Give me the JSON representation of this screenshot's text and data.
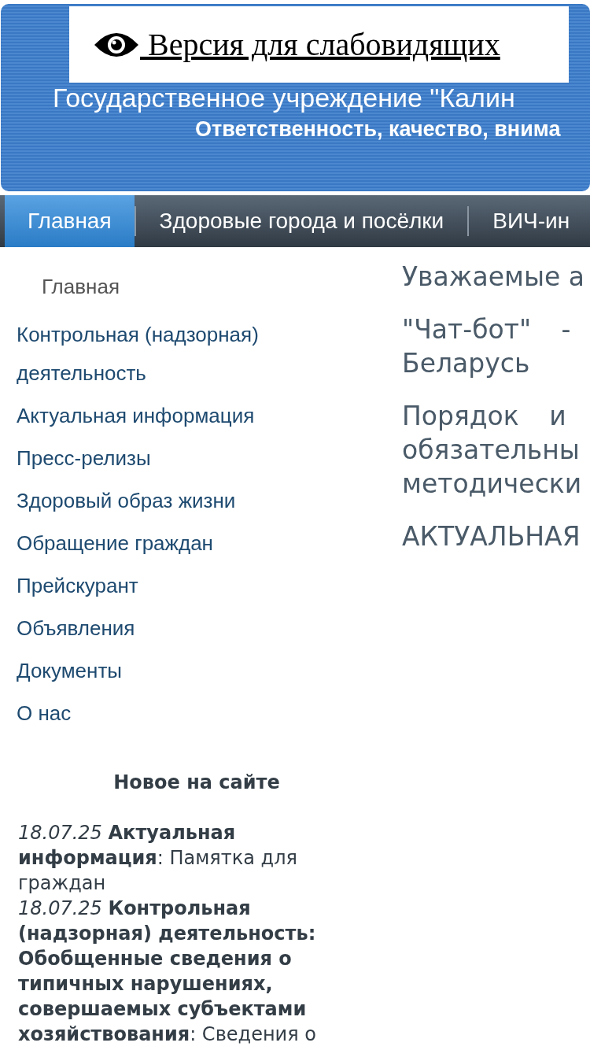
{
  "accessibility_link": {
    "label": " Версия для слабовидящих"
  },
  "header": {
    "title": "Государственное учреждение \"Калин",
    "subtitle": "Ответственность, качество, внима"
  },
  "nav": [
    {
      "label": "Главная",
      "selected": true
    },
    {
      "label": "Здоровые города и посёлки",
      "selected": false
    },
    {
      "label": "ВИЧ-ин",
      "selected": false
    }
  ],
  "sidebar": {
    "items": [
      {
        "label": "Главная",
        "selected": true
      },
      {
        "label": "Контрольная (надзорная) деятельность",
        "selected": false
      },
      {
        "label": "Актуальная информация",
        "selected": false
      },
      {
        "label": "Пресс-релизы",
        "selected": false
      },
      {
        "label": "Здоровый образ жизни",
        "selected": false
      },
      {
        "label": "Обращение граждан",
        "selected": false
      },
      {
        "label": "Прейскурант",
        "selected": false
      },
      {
        "label": "Объявления",
        "selected": false
      },
      {
        "label": "Документы",
        "selected": false
      },
      {
        "label": "О нас",
        "selected": false
      }
    ]
  },
  "news": {
    "title": "Новое на сайте",
    "items": [
      {
        "date": "18.07.25",
        "section": "Актуальная информация",
        "text": ": Памятка для граждан"
      },
      {
        "date": "18.07.25",
        "section": "Контрольная (надзорная) деятельность: Обобщенные сведения о типичных нарушениях, совершаемых субъектами хозяйствования",
        "text": ": Сведения о"
      }
    ]
  },
  "content": {
    "paragraphs": [
      {
        "lines": [
          "Уважаемые а"
        ]
      },
      {
        "lines": [
          "\"Чат-бот\" -",
          "Беларусь"
        ]
      },
      {
        "lines": [
          "Порядок и",
          "обязательны",
          "методически"
        ]
      },
      {
        "lines": [
          "АКТУАЛЬНАЯ"
        ]
      }
    ]
  }
}
